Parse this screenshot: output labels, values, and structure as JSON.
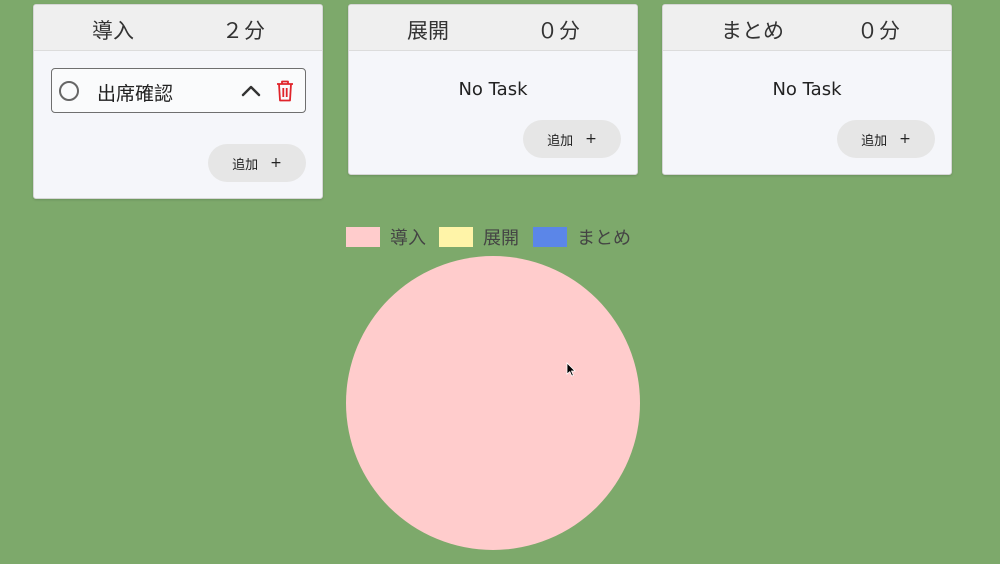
{
  "phases": [
    {
      "id": "intro",
      "title": "導入",
      "minutes_label": "２分",
      "color": "#ffcccc",
      "tasks": [
        {
          "name": "出席確認"
        }
      ],
      "empty_text": "",
      "add_label": "追加",
      "add_icon": "+"
    },
    {
      "id": "develop",
      "title": "展開",
      "minutes_label": "０分",
      "color": "#fff4a8",
      "tasks": [],
      "empty_text": "No Task",
      "add_label": "追加",
      "add_icon": "+"
    },
    {
      "id": "summary",
      "title": "まとめ",
      "minutes_label": "０分",
      "color": "#5b86e8",
      "tasks": [],
      "empty_text": "No Task",
      "add_label": "追加",
      "add_icon": "+"
    }
  ],
  "icons": {
    "task_radio": "radio-unchecked-icon",
    "task_collapse": "chevron-up-icon",
    "task_delete": "trash-icon",
    "add": "plus-icon"
  },
  "colors": {
    "background": "#7da96b",
    "delete": "#e0242b"
  },
  "chart_data": {
    "type": "pie",
    "categories": [
      "導入",
      "展開",
      "まとめ"
    ],
    "values": [
      2,
      0,
      0
    ],
    "colors": [
      "#ffcccc",
      "#fff4a8",
      "#5b86e8"
    ],
    "legend": "top"
  }
}
